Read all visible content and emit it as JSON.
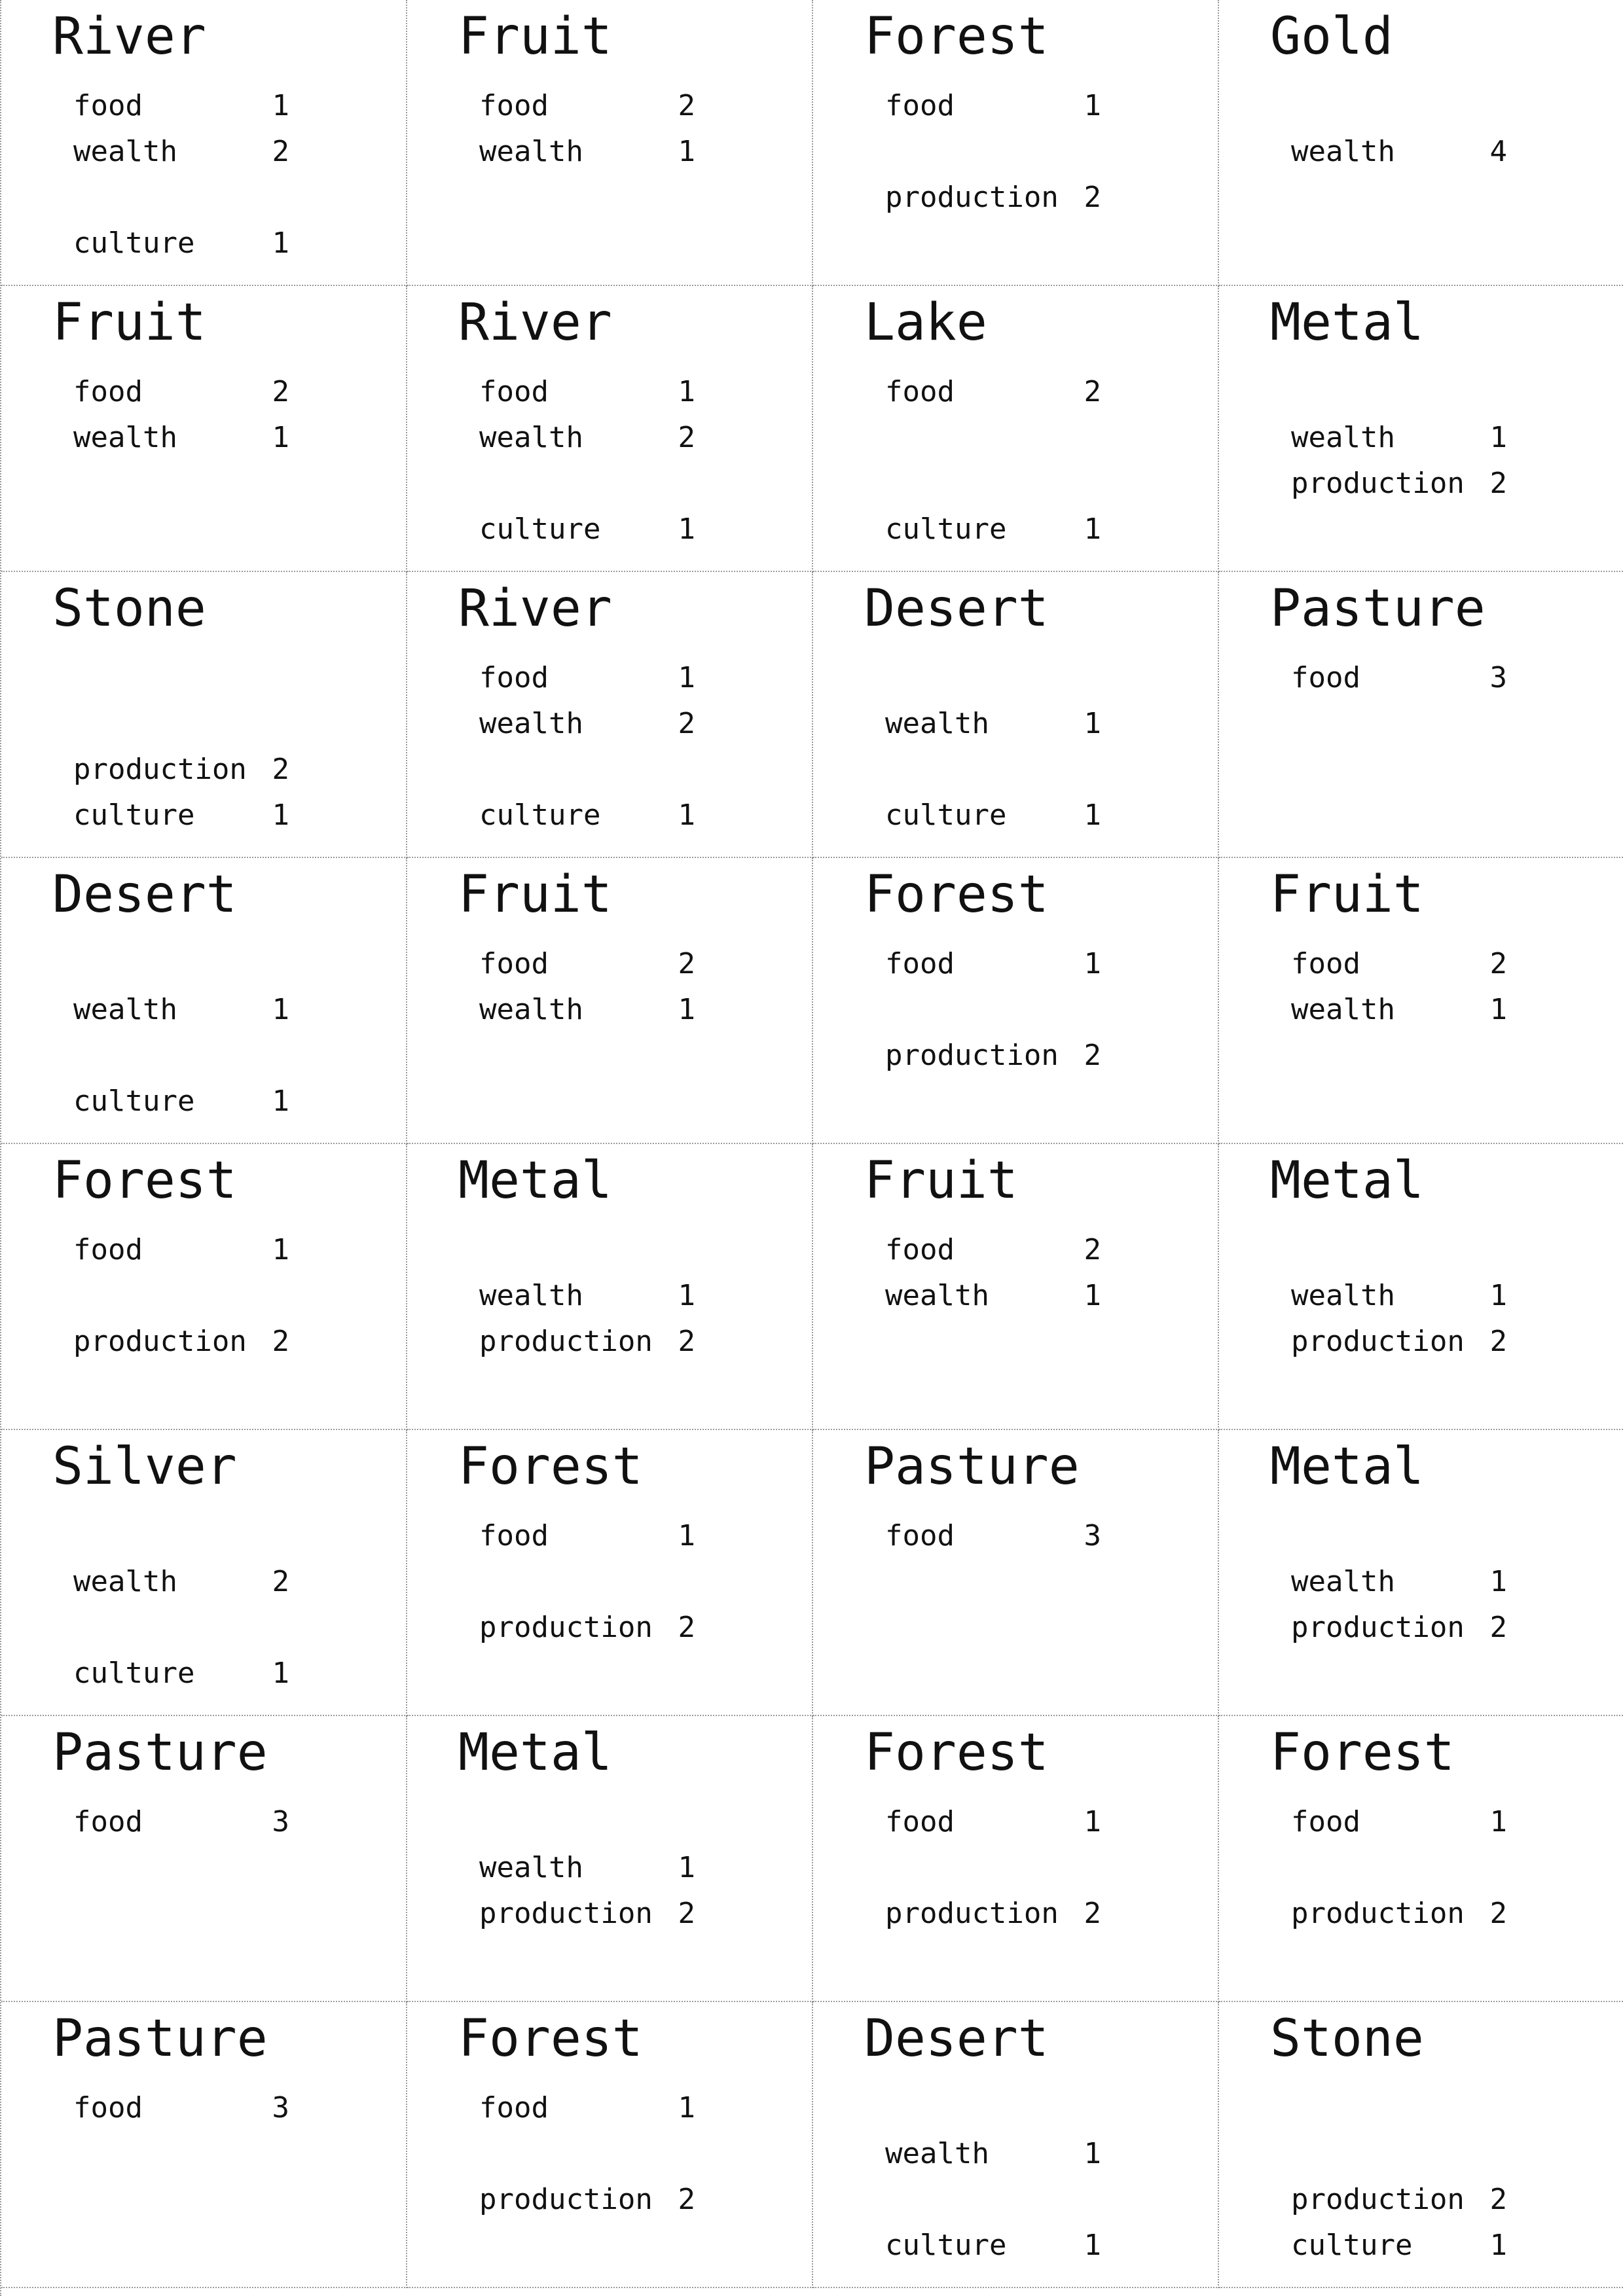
{
  "cards": [
    {
      "title": "River",
      "stats": {
        "food": "1",
        "wealth": "2",
        "culture": "1"
      }
    },
    {
      "title": "Fruit",
      "stats": {
        "food": "2",
        "wealth": "1"
      }
    },
    {
      "title": "Forest",
      "stats": {
        "food": "1",
        "production": "2"
      }
    },
    {
      "title": "Gold",
      "stats": {
        "wealth": "4"
      }
    },
    {
      "title": "Fruit",
      "stats": {
        "food": "2",
        "wealth": "1"
      }
    },
    {
      "title": "River",
      "stats": {
        "food": "1",
        "wealth": "2",
        "culture": "1"
      }
    },
    {
      "title": "Lake",
      "stats": {
        "food": "2",
        "culture": "1"
      }
    },
    {
      "title": "Metal",
      "stats": {
        "wealth": "1",
        "production": "2"
      }
    },
    {
      "title": "Stone",
      "stats": {
        "production": "2",
        "culture": "1"
      }
    },
    {
      "title": "River",
      "stats": {
        "food": "1",
        "wealth": "2",
        "culture": "1"
      }
    },
    {
      "title": "Desert",
      "stats": {
        "wealth": "1",
        "culture": "1"
      }
    },
    {
      "title": "Pasture",
      "stats": {
        "food": "3"
      }
    },
    {
      "title": "Desert",
      "stats": {
        "wealth": "1",
        "culture": "1"
      }
    },
    {
      "title": "Fruit",
      "stats": {
        "food": "2",
        "wealth": "1"
      }
    },
    {
      "title": "Forest",
      "stats": {
        "food": "1",
        "production": "2"
      }
    },
    {
      "title": "Fruit",
      "stats": {
        "food": "2",
        "wealth": "1"
      }
    },
    {
      "title": "Forest",
      "stats": {
        "food": "1",
        "production": "2"
      }
    },
    {
      "title": "Metal",
      "stats": {
        "wealth": "1",
        "production": "2"
      }
    },
    {
      "title": "Fruit",
      "stats": {
        "food": "2",
        "wealth": "1"
      }
    },
    {
      "title": "Metal",
      "stats": {
        "wealth": "1",
        "production": "2"
      }
    },
    {
      "title": "Silver",
      "stats": {
        "wealth": "2",
        "culture": "1"
      }
    },
    {
      "title": "Forest",
      "stats": {
        "food": "1",
        "production": "2"
      }
    },
    {
      "title": "Pasture",
      "stats": {
        "food": "3"
      }
    },
    {
      "title": "Metal",
      "stats": {
        "wealth": "1",
        "production": "2"
      }
    },
    {
      "title": "Pasture",
      "stats": {
        "food": "3"
      }
    },
    {
      "title": "Metal",
      "stats": {
        "wealth": "1",
        "production": "2"
      }
    },
    {
      "title": "Forest",
      "stats": {
        "food": "1",
        "production": "2"
      }
    },
    {
      "title": "Forest",
      "stats": {
        "food": "1",
        "production": "2"
      }
    },
    {
      "title": "Pasture",
      "stats": {
        "food": "3"
      }
    },
    {
      "title": "Forest",
      "stats": {
        "food": "1",
        "production": "2"
      }
    },
    {
      "title": "Desert",
      "stats": {
        "wealth": "1",
        "culture": "1"
      }
    },
    {
      "title": "Stone",
      "stats": {
        "production": "2",
        "culture": "1"
      }
    }
  ]
}
